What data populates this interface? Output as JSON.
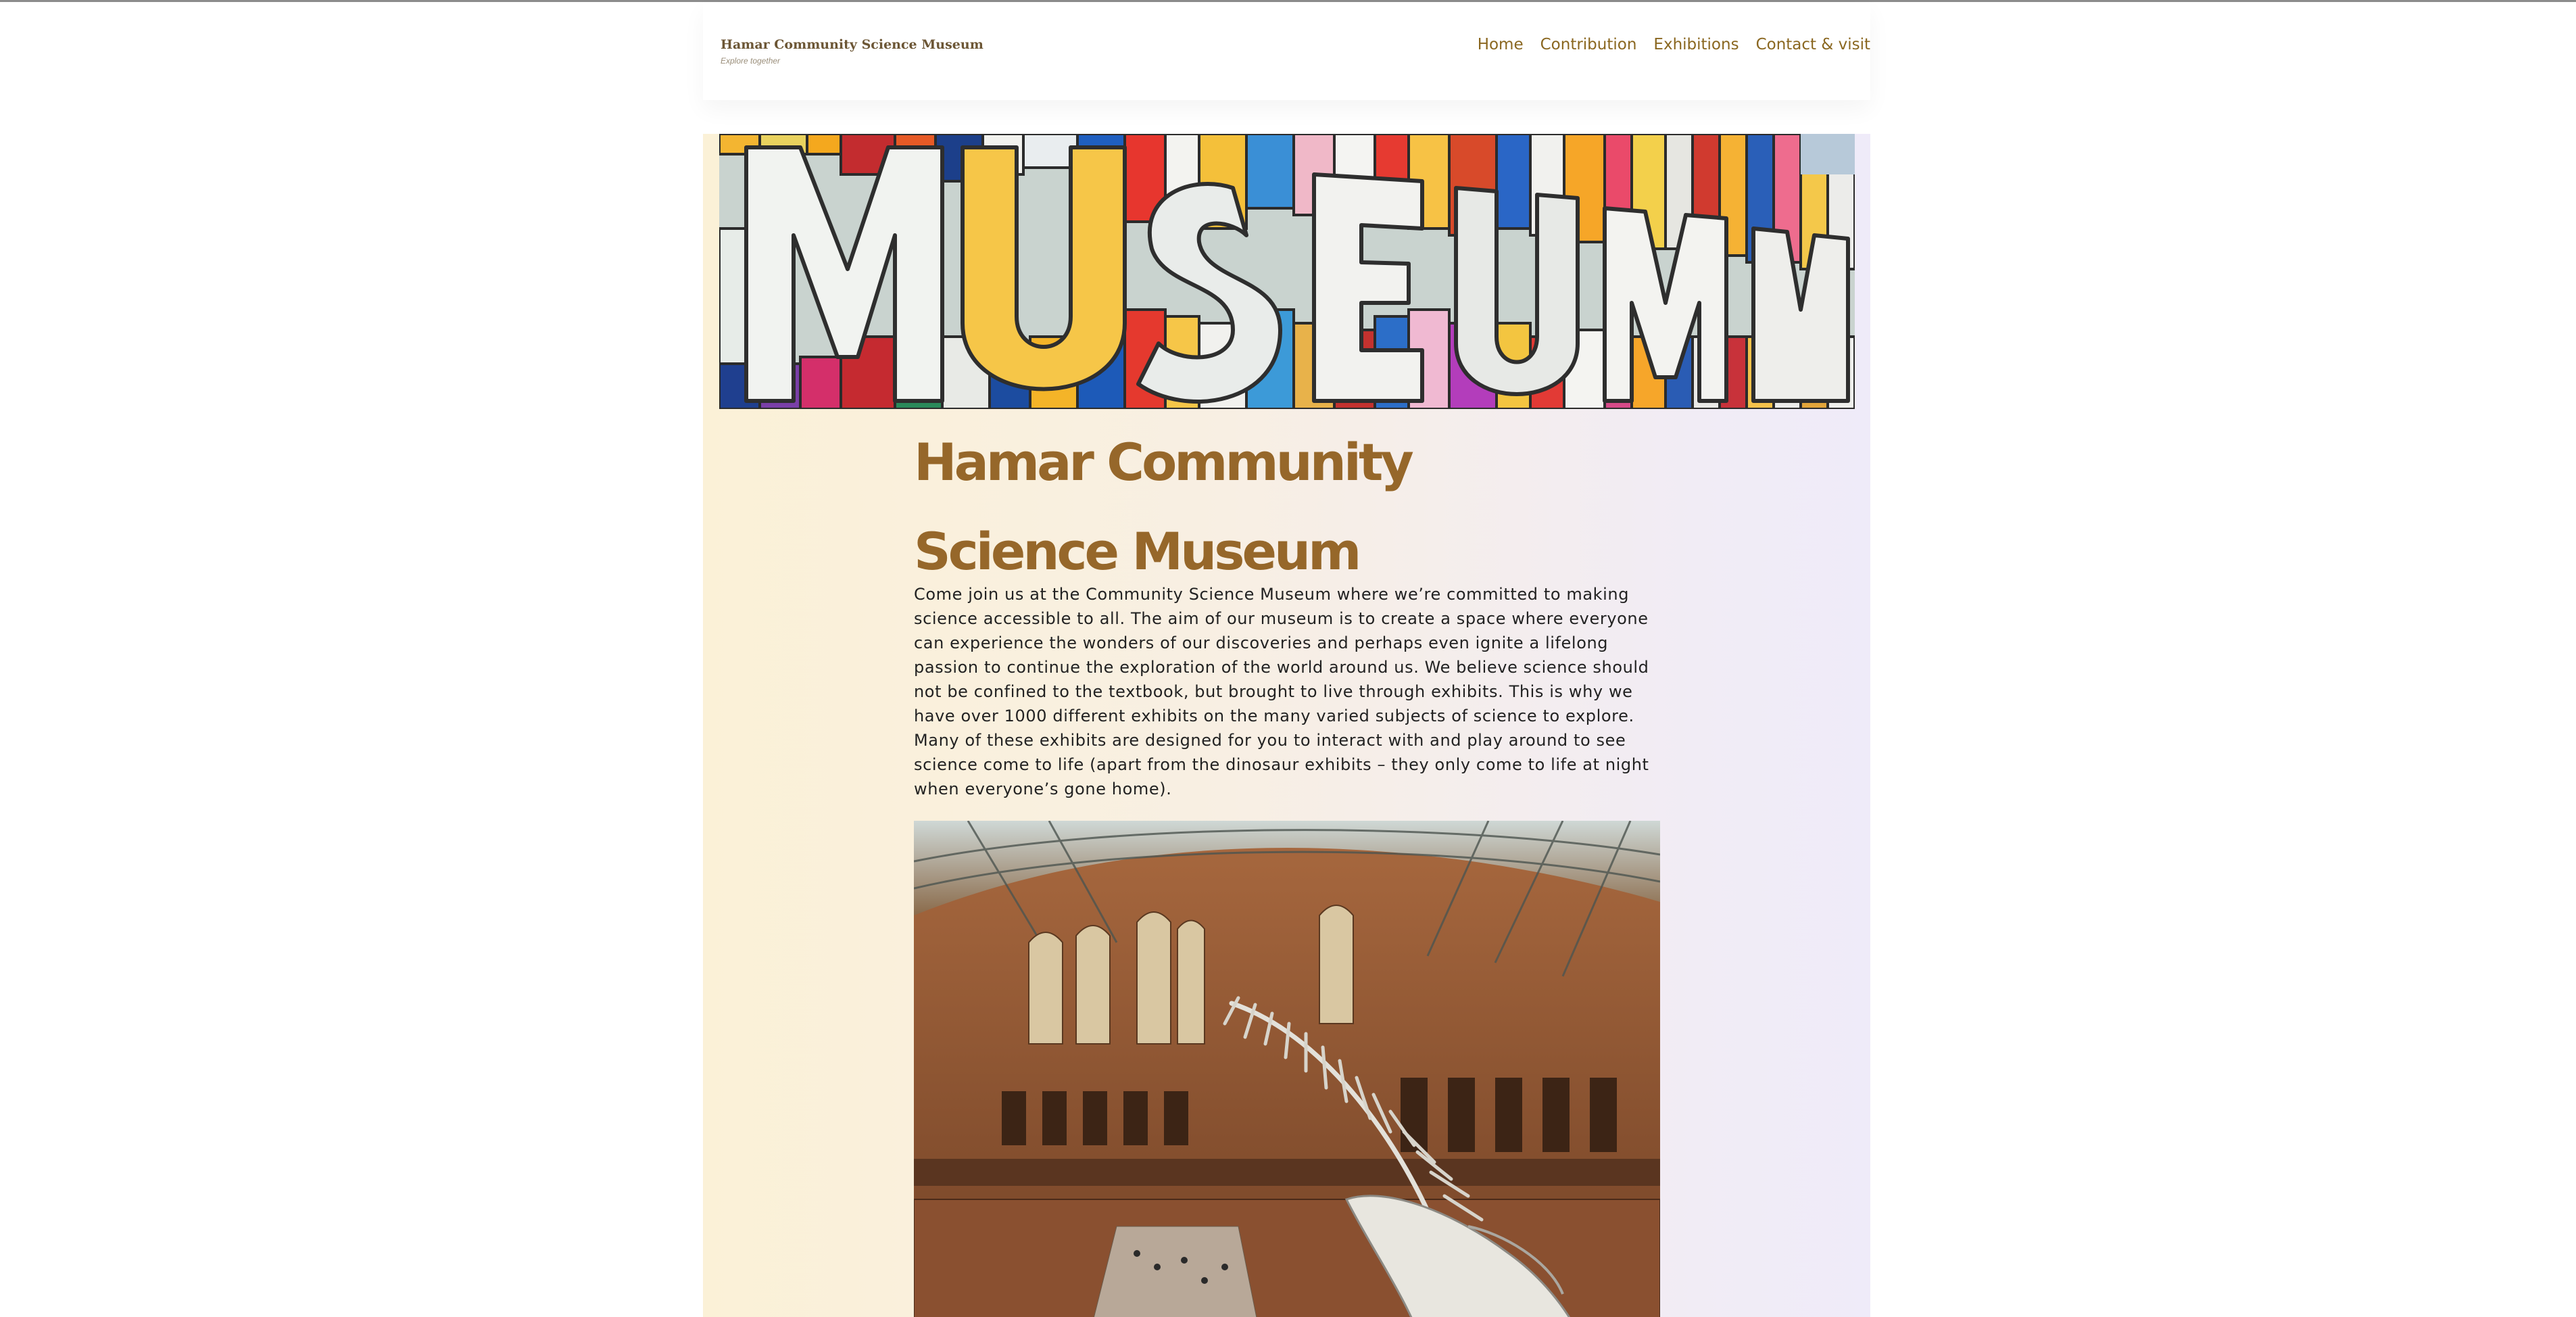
{
  "site": {
    "name": "Hamar Community Science Museum",
    "tagline": "Explore together"
  },
  "nav": {
    "items": [
      {
        "label": "Home"
      },
      {
        "label": "Contribution"
      },
      {
        "label": "Exhibitions"
      },
      {
        "label": "Contact & visit"
      }
    ]
  },
  "main": {
    "title": "Hamar Community Science Museum",
    "intro": "Come join us at the Community Science Museum where we’re committed to making science accessible to all. The aim of our museum is to create a space where everyone can experience the wonders of our discoveries and perhaps even ignite a lifelong passion to continue the exploration of the world around us. We believe science should not be confined to the textbook, but brought to live through exhibits. This is why we have over 1000 different exhibits on the many varied subjects of science to explore. Many of these exhibits are designed for you to interact with and play around to see science come to life (apart from the dinosaur exhibits – they only come to life at night when everyone’s gone home)."
  },
  "images": {
    "hero": "colorful-museum-lettering-facade",
    "hall": "museum-hall-whale-skeleton"
  },
  "icons": {
    "logo": "mammoth-icon"
  },
  "colors": {
    "accent": "#96672a",
    "nav_link": "#8a6720",
    "logo_text": "#6c5635",
    "body_text": "#222222",
    "bg_left": "#fbf1d7",
    "bg_right": "#efebf9"
  }
}
